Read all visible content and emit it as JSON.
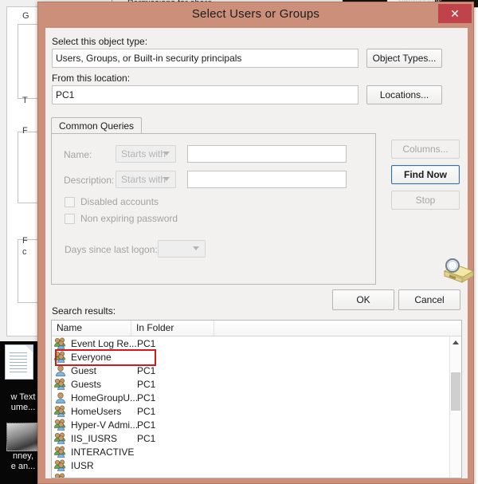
{
  "background": {
    "top_window_title": "Permissions for share",
    "far_right_label": "Permissions",
    "left_letters": [
      "G",
      "T",
      "F",
      "F",
      "c"
    ],
    "desktop_icons": [
      {
        "name": "new-text-document",
        "label": "w Text\nume..."
      },
      {
        "name": "picture-file",
        "label": "nney,\ne an..."
      }
    ]
  },
  "dialog": {
    "title": "Select Users or Groups",
    "close_label": "✕",
    "object_type": {
      "label": "Select this object type:",
      "value": "Users, Groups, or Built-in security principals",
      "button": "Object Types..."
    },
    "location": {
      "label": "From this location:",
      "value": "PC1",
      "button": "Locations..."
    },
    "tab": "Common Queries",
    "query": {
      "name_label": "Name:",
      "name_operator": "Starts with",
      "name_value": "",
      "description_label": "Description:",
      "description_operator": "Starts with",
      "description_value": "",
      "disabled_accounts": "Disabled accounts",
      "non_expiring_password": "Non expiring password",
      "days_label": "Days since last logon:",
      "days_value": ""
    },
    "side_buttons": {
      "columns": "Columns...",
      "find_now": "Find Now",
      "stop": "Stop"
    },
    "footer_buttons": {
      "ok": "OK",
      "cancel": "Cancel"
    },
    "results": {
      "label": "Search results:",
      "columns": [
        "Name",
        "In Folder"
      ],
      "highlighted_row": "Everyone",
      "rows": [
        {
          "icon": "group-icon",
          "name": "Event Log Re...",
          "folder": "PC1"
        },
        {
          "icon": "group-icon",
          "name": "Everyone",
          "folder": ""
        },
        {
          "icon": "user-icon",
          "name": "Guest",
          "folder": "PC1"
        },
        {
          "icon": "group-icon",
          "name": "Guests",
          "folder": "PC1"
        },
        {
          "icon": "user-icon",
          "name": "HomeGroupU...",
          "folder": "PC1"
        },
        {
          "icon": "group-icon",
          "name": "HomeUsers",
          "folder": "PC1"
        },
        {
          "icon": "group-icon",
          "name": "Hyper-V Admi...",
          "folder": "PC1"
        },
        {
          "icon": "group-icon",
          "name": "IIS_IUSRS",
          "folder": "PC1"
        },
        {
          "icon": "group-icon",
          "name": "INTERACTIVE",
          "folder": ""
        },
        {
          "icon": "group-icon",
          "name": "IUSR",
          "folder": ""
        }
      ]
    }
  },
  "colors": {
    "dialog_frame": "#cc8f79",
    "close_button": "#c0434b",
    "highlight_rect": "#d41a18",
    "default_button_border": "#2e6fb0",
    "client_bg": "#f2f1f0"
  }
}
